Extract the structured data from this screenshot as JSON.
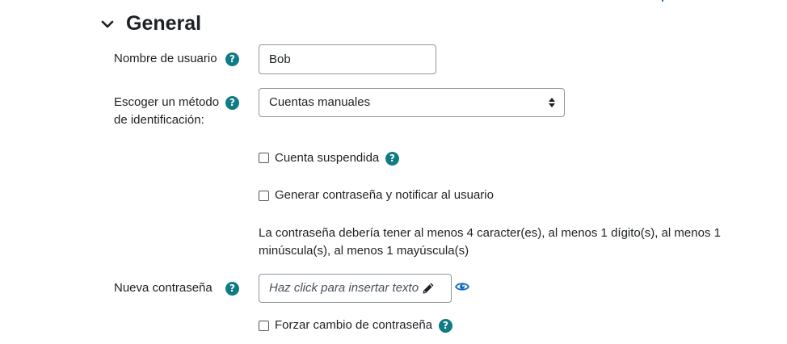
{
  "section": {
    "title": "General",
    "icons": {
      "collapse": "chevron-down-icon"
    }
  },
  "fields": {
    "username": {
      "label": "Nombre de usuario",
      "value": "Bob"
    },
    "auth": {
      "label_line1": "Escoger un método",
      "label_line2": "de identificación:",
      "selected": "Cuentas manuales"
    },
    "suspended": {
      "label": "Cuenta suspendida",
      "checked": false
    },
    "generate_password": {
      "label": "Generar contraseña y notificar al usuario",
      "checked": false
    },
    "password_policy": {
      "line1": "La contraseña debería tener al menos 4 caracter(es), al menos 1 dígito(s), al menos 1",
      "line2": "minúscula(s), al menos 1 mayúscula(s)"
    },
    "new_password": {
      "label": "Nueva contraseña",
      "placeholder": "Haz click para insertar texto",
      "icons": {
        "edit": "pencil-icon",
        "reveal": "eye-icon"
      }
    },
    "force_change": {
      "label": "Forzar cambio de contraseña",
      "checked": false
    }
  },
  "help_glyph": "?",
  "colors": {
    "help_badge": "#0f7b84",
    "reveal_icon": "#0f6cbf",
    "border": "#8f959e",
    "text": "#1d2125"
  }
}
